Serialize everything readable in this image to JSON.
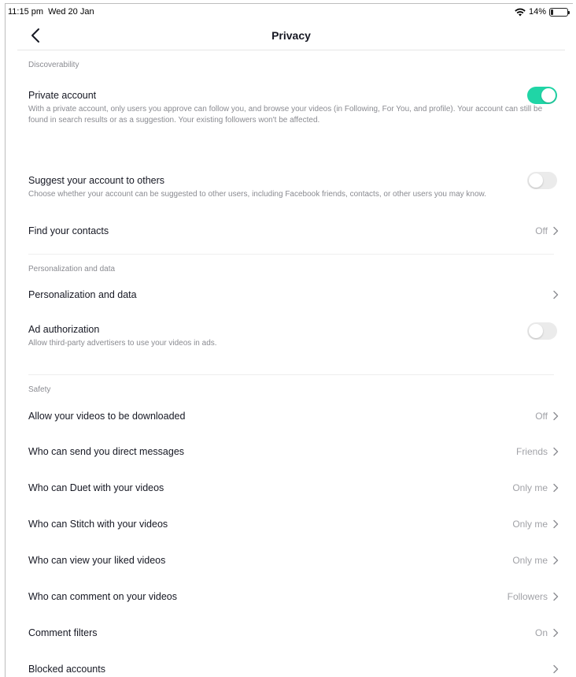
{
  "status": {
    "time": "11:15 pm",
    "date": "Wed 20 Jan",
    "battery": "14%",
    "battery_level": 0.14
  },
  "nav": {
    "title": "Privacy"
  },
  "colors": {
    "accent": "#20d5a6",
    "text": "#161823",
    "muted": "#8a8b91"
  },
  "sections": {
    "discoverability": {
      "header": "Discoverability",
      "private_account": {
        "title": "Private account",
        "desc": "With a private account, only users you approve can follow you, and browse your videos (in Following, For You, and profile). Your account can still be found in search results or as a suggestion. Your existing followers won't be affected.",
        "on": true
      },
      "suggest": {
        "title": "Suggest your account to others",
        "desc": "Choose whether your account can be suggested to other users, including Facebook friends, contacts, or other users you may know.",
        "on": false
      },
      "find_contacts": {
        "title": "Find your contacts",
        "value": "Off"
      }
    },
    "personalization": {
      "header": "Personalization and data",
      "personalization_row": {
        "title": "Personalization and data"
      },
      "ad_auth": {
        "title": "Ad authorization",
        "desc": "Allow third-party advertisers to use your videos in ads.",
        "on": false
      }
    },
    "safety": {
      "header": "Safety",
      "items": [
        {
          "title": "Allow your videos to be downloaded",
          "value": "Off"
        },
        {
          "title": "Who can send you direct messages",
          "value": "Friends"
        },
        {
          "title": "Who can Duet with your videos",
          "value": "Only me"
        },
        {
          "title": "Who can Stitch with your videos",
          "value": "Only me"
        },
        {
          "title": "Who can view your liked videos",
          "value": "Only me"
        },
        {
          "title": "Who can comment on your videos",
          "value": "Followers"
        },
        {
          "title": "Comment filters",
          "value": "On"
        },
        {
          "title": "Blocked accounts",
          "value": ""
        }
      ]
    }
  }
}
